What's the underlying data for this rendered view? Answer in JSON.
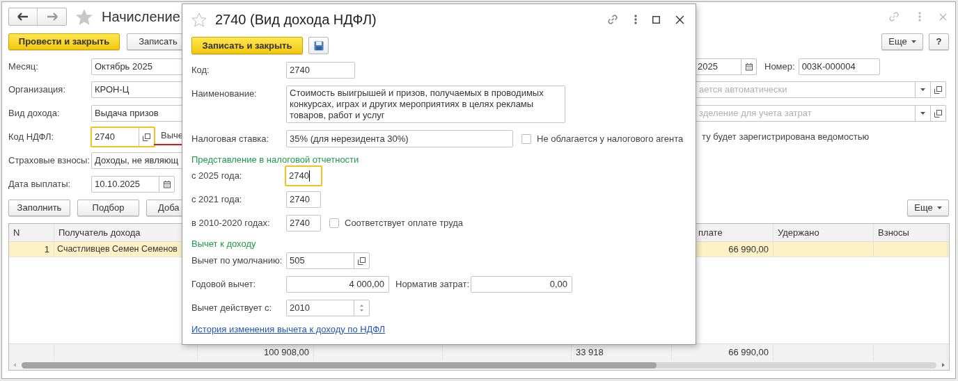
{
  "window": {
    "title": "Начисление",
    "more": "Еще",
    "help": "?"
  },
  "toolbar": [
    {
      "label": "Провести и закрыть",
      "kind": "primary"
    },
    {
      "label": "Записать",
      "kind": "default"
    }
  ],
  "fields": {
    "month": {
      "label": "Месяц:",
      "value": "Октябрь 2025"
    },
    "organization": {
      "label": "Организация:",
      "value": "КРОН-Ц"
    },
    "income_type": {
      "label": "Вид дохода:",
      "value": "Выдача призов"
    },
    "ndfl_code": {
      "label": "Код НДФЛ:",
      "value": "2740",
      "highlighted": true,
      "side_label": "Выче"
    },
    "insurance": {
      "label": "Страховые взносы:",
      "value": "Доходы, не являющ"
    },
    "pay_date": {
      "label": "Дата выплаты:",
      "value": "10.10.2025"
    },
    "date": {
      "value": "2025"
    },
    "number": {
      "label": "Номер:",
      "value": "003К-000004"
    },
    "responsible": {
      "placeholder": "ается автоматически"
    },
    "division": {
      "placeholder": "зделение для учета затрат"
    },
    "note": "ту будет зарегистрирована ведомостью"
  },
  "table_toolbar": {
    "buttons": [
      "Заполнить",
      "Подбор",
      "Доба"
    ],
    "more": "Еще"
  },
  "table": {
    "columns": [
      "N",
      "Получатель дохода",
      "плате",
      "Удержано",
      "Взносы"
    ],
    "rows": [
      {
        "selected": true,
        "cells": [
          "1",
          "Счастливцев Семен Семенов",
          "66 990,00"
        ]
      }
    ],
    "totals": [
      "100 908,00",
      "33 918",
      "66 990,00"
    ]
  },
  "dialog": {
    "title": "2740 (Вид дохода НДФЛ)",
    "save_close": "Записать и закрыть",
    "code": {
      "label": "Код:",
      "value": "2740"
    },
    "name": {
      "label": "Наименование:",
      "value": "Стоимость выигрышей и призов, получаемых в проводимых конкурсах, играх и других мероприятиях в целях рекламы товаров, работ и услуг"
    },
    "rate": {
      "label": "Налоговая ставка:",
      "value": "35% (для нерезидента 30%)"
    },
    "not_taxed": {
      "label": "Не облагается у налогового агента",
      "checked": false
    },
    "report_section": "Представление в налоговой отчетности",
    "report_codes": [
      {
        "label": "с 2025 года:",
        "value": "2740",
        "highlighted": true
      },
      {
        "label": "с 2021 года:",
        "value": "2740",
        "highlighted": false
      },
      {
        "label": "в 2010-2020 годах:",
        "value": "2740",
        "highlighted": false
      }
    ],
    "labor": {
      "label": "Соответствует оплате труда",
      "checked": false
    },
    "deduction_section": "Вычет к доходу",
    "default_deduction": {
      "label": "Вычет по умолчанию:",
      "value": "505"
    },
    "annual": {
      "label": "Годовой вычет:",
      "value": "4 000,00"
    },
    "cost_norm": {
      "label": "Норматив затрат:",
      "value": "0,00"
    },
    "valid_from": {
      "label": "Вычет действует с:",
      "value": "2010"
    },
    "history_link": "История изменения вычета к доходу по НДФЛ"
  }
}
